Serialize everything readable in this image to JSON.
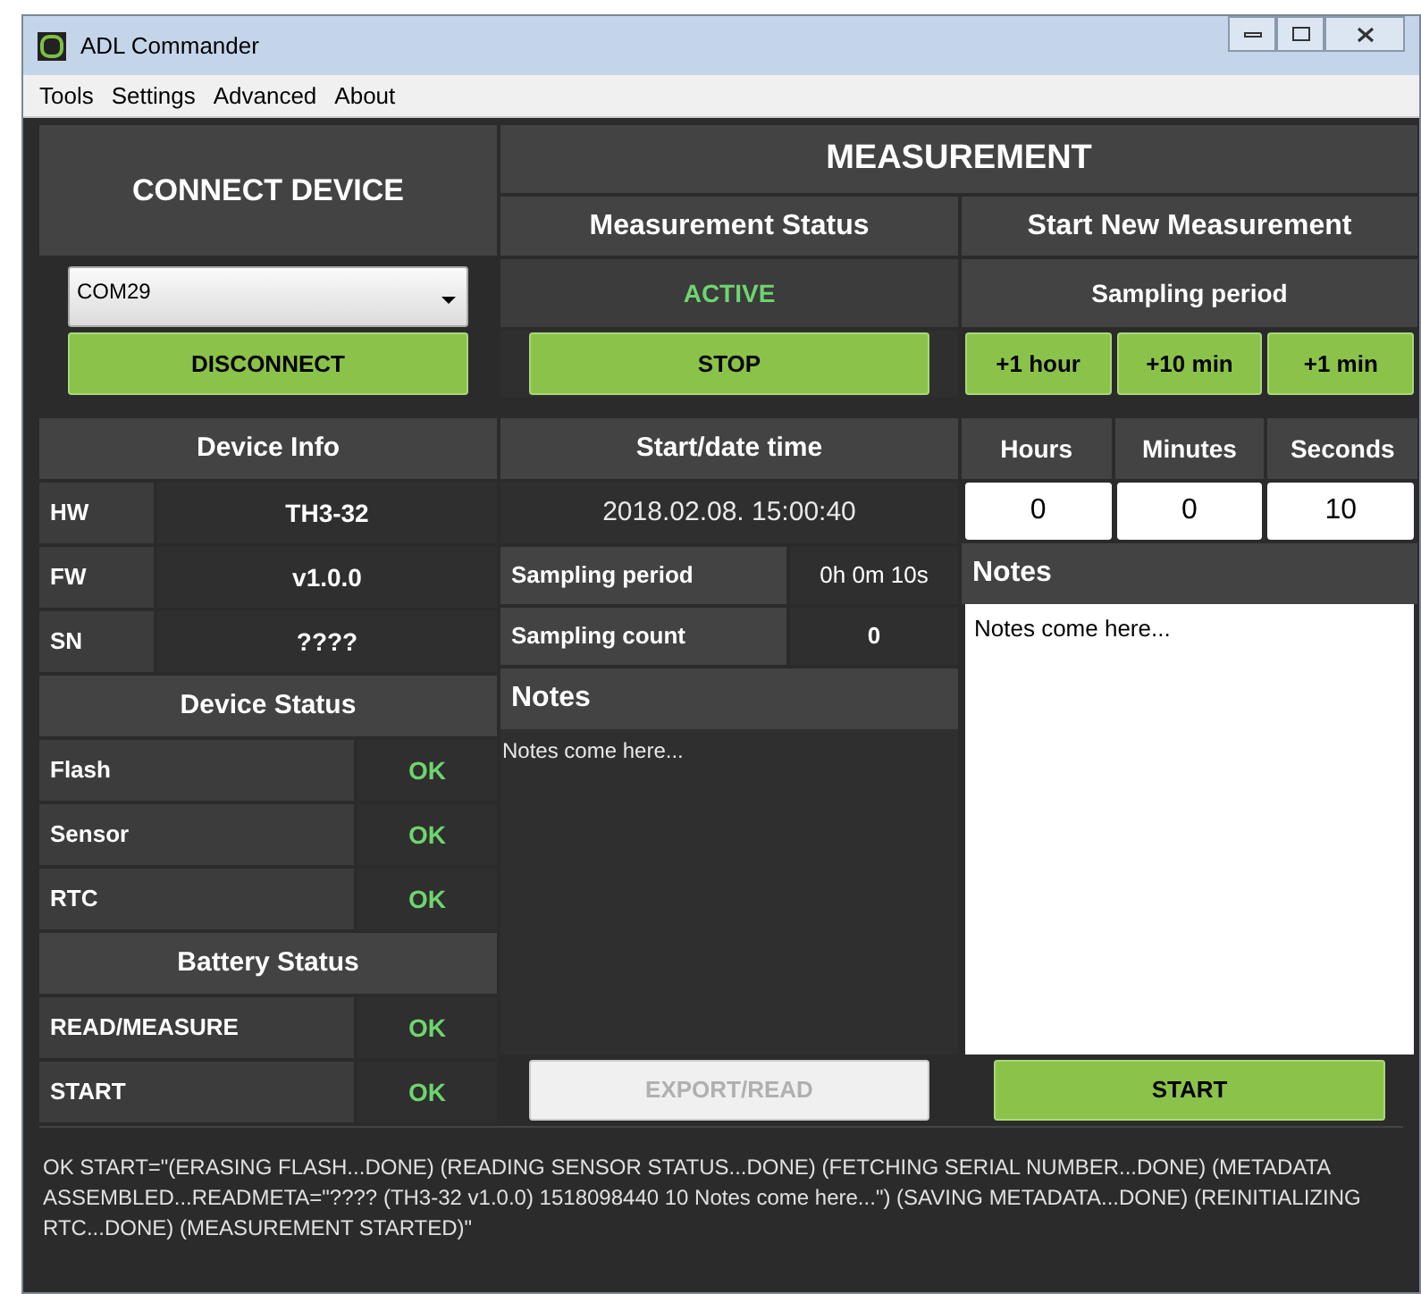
{
  "window": {
    "title": "ADL Commander"
  },
  "menu": [
    "Tools",
    "Settings",
    "Advanced",
    "About"
  ],
  "connect": {
    "title": "CONNECT DEVICE",
    "port": "COM29",
    "button": "DISCONNECT"
  },
  "measurement": {
    "title": "MEASUREMENT",
    "status_heading": "Measurement Status",
    "status": "ACTIVE",
    "stop_button": "STOP",
    "start_new_heading": "Start New Measurement",
    "sampling_period_heading": "Sampling period",
    "increment_buttons": [
      "+1 hour",
      "+10 min",
      "+1 min"
    ]
  },
  "device_info": {
    "title": "Device Info",
    "rows": [
      {
        "label": "HW",
        "value": "TH3-32"
      },
      {
        "label": "FW",
        "value": "v1.0.0"
      },
      {
        "label": "SN",
        "value": "????"
      }
    ]
  },
  "device_status": {
    "title": "Device Status",
    "rows": [
      {
        "label": "Flash",
        "value": "OK"
      },
      {
        "label": "Sensor",
        "value": "OK"
      },
      {
        "label": "RTC",
        "value": "OK"
      }
    ]
  },
  "battery_status": {
    "title": "Battery Status",
    "rows": [
      {
        "label": "READ/MEASURE",
        "value": "OK"
      },
      {
        "label": "START",
        "value": "OK"
      }
    ]
  },
  "current": {
    "start_heading": "Start/date time",
    "start_value": "2018.02.08. 15:00:40",
    "details": [
      {
        "label": "Sampling period",
        "value": "0h 0m 10s"
      },
      {
        "label": "Sampling count",
        "value": "0"
      }
    ],
    "notes_heading": "Notes",
    "notes": "Notes come here...",
    "export_button": {
      "label": "EXPORT/READ",
      "disabled": true
    }
  },
  "new_measurement": {
    "fields": [
      {
        "label": "Hours",
        "value": "0"
      },
      {
        "label": "Minutes",
        "value": "0"
      },
      {
        "label": "Seconds",
        "value": "10"
      }
    ],
    "notes_heading": "Notes",
    "notes": "Notes come here...",
    "start_button": "START"
  },
  "log": "OK START=\"(ERASING FLASH...DONE) (READING SENSOR STATUS...DONE) (FETCHING SERIAL NUMBER...DONE) (METADATA ASSEMBLED...READMETA=\"???? (TH3-32 v1.0.0) 1518098440 10 Notes come here...\") (SAVING METADATA...DONE) (REINITIALIZING RTC...DONE) (MEASUREMENT STARTED)\""
}
